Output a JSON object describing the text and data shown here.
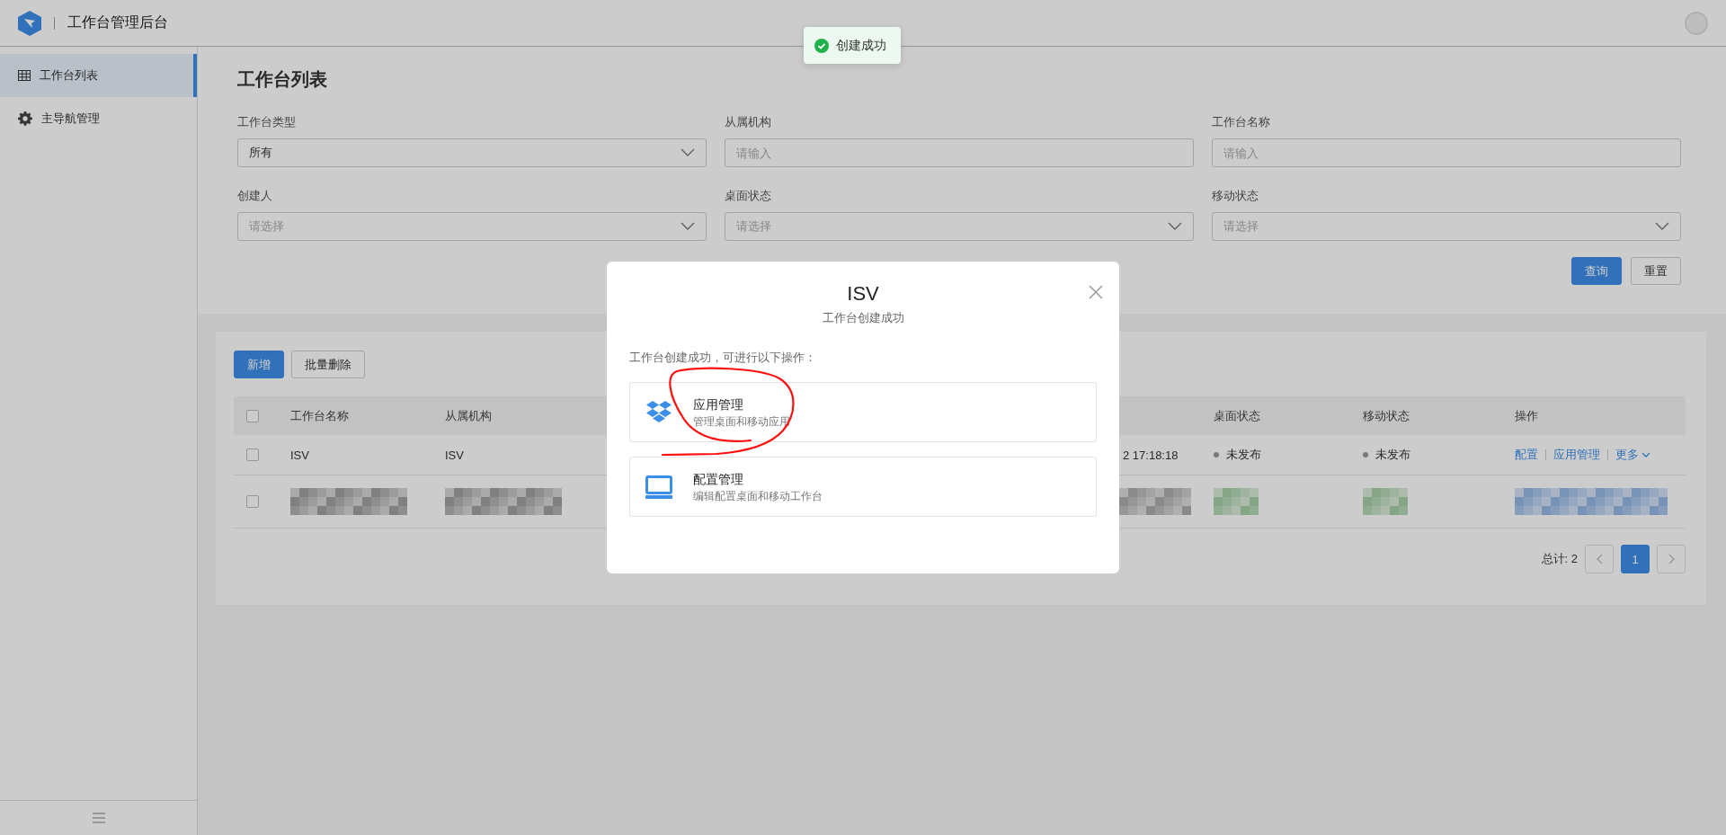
{
  "header": {
    "title": "工作台管理后台"
  },
  "toast": {
    "kind": "success",
    "text": "创建成功"
  },
  "sidebar": {
    "items": [
      {
        "label": "工作台列表",
        "selected": true
      },
      {
        "label": "主导航管理",
        "selected": false
      }
    ]
  },
  "filter": {
    "title": "工作台列表",
    "fields": [
      {
        "label": "工作台类型",
        "kind": "select",
        "value": "所有"
      },
      {
        "label": "从属机构",
        "kind": "input",
        "placeholder": "请输入"
      },
      {
        "label": "工作台名称",
        "kind": "input",
        "placeholder": "请输入"
      },
      {
        "label": "创建人",
        "kind": "select",
        "placeholder": "请选择"
      },
      {
        "label": "桌面状态",
        "kind": "select",
        "placeholder": "请选择"
      },
      {
        "label": "移动状态",
        "kind": "select",
        "placeholder": "请选择"
      }
    ],
    "buttons": [
      {
        "label": "查询",
        "kind": "primary"
      },
      {
        "label": "重置",
        "kind": "default"
      }
    ]
  },
  "table": {
    "buttons": [
      {
        "label": "新增",
        "kind": "primary"
      },
      {
        "label": "批量删除",
        "kind": "default"
      }
    ],
    "header_checked": false,
    "columns": [
      "工作台名称",
      "从属机构",
      "桌面状态",
      "移动状态",
      "操作"
    ],
    "rows": [
      {
        "kind": "text",
        "checked": false,
        "name": "ISV",
        "org": "ISV",
        "created": "2 17:18:18",
        "desktop_status": "未发布",
        "mobile_status": "未发布",
        "actions": [
          "配置",
          "应用管理",
          "更多"
        ]
      },
      {
        "kind": "pixelated",
        "checked": false
      }
    ]
  },
  "pagination": {
    "total": "总计: 2",
    "pages": [
      {
        "label": "1",
        "selected": true
      }
    ]
  },
  "modal": {
    "title": "ISV",
    "subtitle": "工作台创建成功",
    "intro": "工作台创建成功，可进行以下操作：",
    "options": [
      {
        "title": "应用管理",
        "description": "管理桌面和移动应用",
        "annotated": true
      },
      {
        "title": "配置管理",
        "description": "编辑配置桌面和移动工作台",
        "annotated": false
      }
    ]
  }
}
